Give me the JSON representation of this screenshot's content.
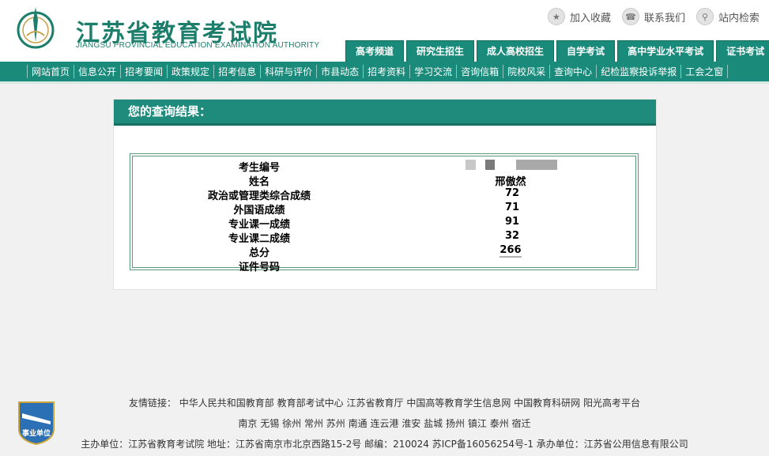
{
  "header": {
    "title_cn": "江苏省教育考试院",
    "title_en": "JIANGSU PROVINCIAL EDUCATION EXAMINATION AUTHORITY",
    "links": [
      {
        "label": "加入收藏",
        "icon": "bookmark-icon"
      },
      {
        "label": "联系我们",
        "icon": "contact-icon"
      },
      {
        "label": "站内检索",
        "icon": "search-icon"
      }
    ],
    "tabs": [
      "高考频道",
      "研究生招生",
      "成人高校招生",
      "自学考试",
      "高中学业水平考试",
      "证书考试"
    ]
  },
  "nav": [
    "网站首页",
    "信息公开",
    "招考要闻",
    "政策规定",
    "招考信息",
    "科研与评价",
    "市县动态",
    "招考资料",
    "学习交流",
    "咨询信箱",
    "院校风采",
    "查询中心",
    "纪检监察投诉举报",
    "工会之窗"
  ],
  "result": {
    "heading": "您的查询结果：",
    "rows": [
      {
        "label": "考生编号",
        "value": ""
      },
      {
        "label": "姓名",
        "value": "邢傲然"
      },
      {
        "label": "政治或管理类综合成绩",
        "value": "72"
      },
      {
        "label": "外国语成绩",
        "value": "71"
      },
      {
        "label": "专业课一成绩",
        "value": "91"
      },
      {
        "label": "专业课二成绩",
        "value": "32"
      },
      {
        "label": "总分",
        "value": "266"
      },
      {
        "label": "证件号码",
        "value": ""
      }
    ]
  },
  "footer": {
    "friend_links_label": "友情链接：",
    "friend_links": [
      "中华人民共和国教育部",
      "教育部考试中心",
      "江苏省教育厅",
      "中国高等教育学生信息网",
      "中国教育科研网",
      "阳光高考平台"
    ],
    "cities": [
      "南京",
      "无锡",
      "徐州",
      "常州",
      "苏州",
      "南通",
      "连云港",
      "淮安",
      "盐城",
      "扬州",
      "镇江",
      "泰州",
      "宿迁"
    ],
    "host": "主办单位：江苏省教育考试院",
    "address": "地址：江苏省南京市北京西路15-2号",
    "postcode": "邮编：210024",
    "icp": "苏ICP备16056254号-1",
    "contractor": "承办单位：江苏省公用信息有限公司",
    "badge_text": "事业单位"
  }
}
